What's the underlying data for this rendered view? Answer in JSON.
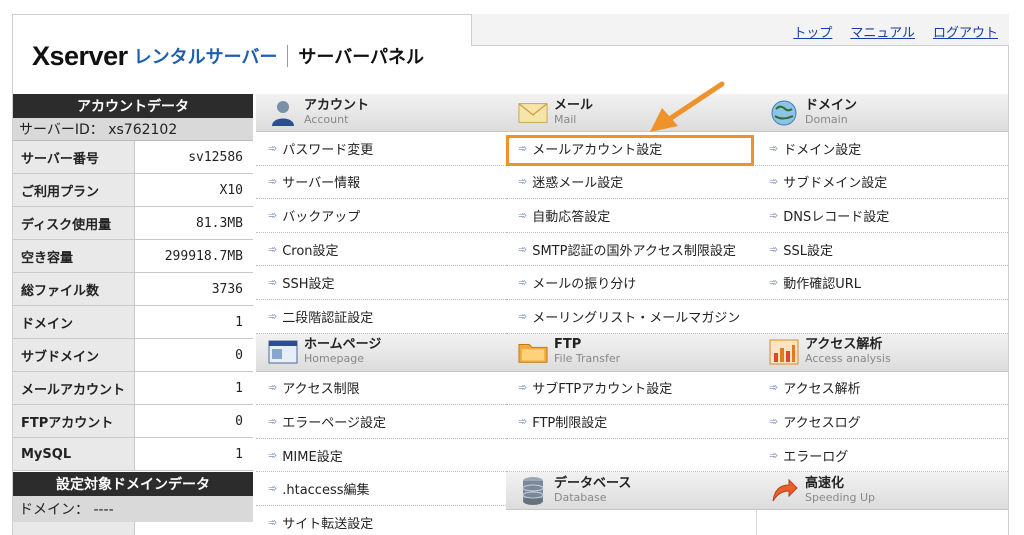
{
  "header": {
    "logo_brand": "Xserver",
    "logo_service": "レンタルサーバー",
    "logo_panel": "サーバーパネル",
    "links": [
      "トップ",
      "マニュアル",
      "ログアウト"
    ]
  },
  "account": {
    "title": "アカウントデータ",
    "server_id": "サーバーID： xs762102",
    "rows": [
      {
        "k": "サーバー番号",
        "v": "sv12586"
      },
      {
        "k": "ご利用プラン",
        "v": "X10"
      },
      {
        "k": "ディスク使用量",
        "v": "81.3MB"
      },
      {
        "k": "空き容量",
        "v": "299918.7MB"
      },
      {
        "k": "総ファイル数",
        "v": "3736"
      },
      {
        "k": "ドメイン",
        "v": "1"
      },
      {
        "k": "サブドメイン",
        "v": "0"
      },
      {
        "k": "メールアカウント",
        "v": "1"
      },
      {
        "k": "FTPアカウント",
        "v": "0"
      },
      {
        "k": "MySQL",
        "v": "1"
      }
    ],
    "domain_title": "設定対象ドメインデータ",
    "domain_value": "ドメイン： ----"
  },
  "menu": {
    "account": {
      "jp": "アカウント",
      "en": "Account",
      "items": [
        "パスワード変更",
        "サーバー情報",
        "バックアップ",
        "Cron設定",
        "SSH設定",
        "二段階認証設定"
      ]
    },
    "homepage": {
      "jp": "ホームページ",
      "en": "Homepage",
      "items": [
        "アクセス制限",
        "エラーページ設定",
        "MIME設定",
        ".htaccess編集",
        "サイト転送設定"
      ]
    },
    "mail": {
      "jp": "メール",
      "en": "Mail",
      "items": [
        "メールアカウント設定",
        "迷惑メール設定",
        "自動応答設定",
        "SMTP認証の国外アクセス制限設定",
        "メールの振り分け",
        "メーリングリスト・メールマガジン"
      ]
    },
    "ftp": {
      "jp": "FTP",
      "en": "File Transfer",
      "items": [
        "サブFTPアカウント設定",
        "FTP制限設定"
      ]
    },
    "database": {
      "jp": "データベース",
      "en": "Database"
    },
    "domain": {
      "jp": "ドメイン",
      "en": "Domain",
      "items": [
        "ドメイン設定",
        "サブドメイン設定",
        "DNSレコード設定",
        "SSL設定",
        "動作確認URL"
      ]
    },
    "access": {
      "jp": "アクセス解析",
      "en": "Access analysis",
      "items": [
        "アクセス解析",
        "アクセスログ",
        "エラーログ"
      ]
    },
    "speed": {
      "jp": "高速化",
      "en": "Speeding Up"
    }
  },
  "colors": {
    "highlight": "#f0922c",
    "link": "#1a3aa8",
    "header_dark": "#2c2c2c"
  }
}
